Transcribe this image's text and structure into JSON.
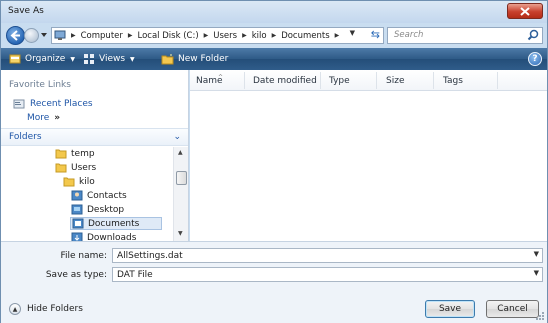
{
  "window": {
    "title": "Save As"
  },
  "address": {
    "crumbs": [
      "Computer",
      "Local Disk (C:)",
      "Users",
      "kilo",
      "Documents"
    ],
    "search_placeholder": "Search"
  },
  "toolbar": {
    "organize": "Organize",
    "views": "Views",
    "new_folder": "New Folder"
  },
  "nav": {
    "favorite_links_title": "Favorite Links",
    "favorites": [
      {
        "label": "Recent Places"
      }
    ],
    "more": "More",
    "more_glyph": "»",
    "folders_title": "Folders",
    "tree": [
      {
        "label": "temp"
      },
      {
        "label": "Users"
      },
      {
        "label": "kilo"
      },
      {
        "label": "Contacts"
      },
      {
        "label": "Desktop"
      },
      {
        "label": "Documents"
      },
      {
        "label": "Downloads"
      }
    ]
  },
  "filelist": {
    "columns": [
      "Name",
      "Date modified",
      "Type",
      "Size",
      "Tags"
    ]
  },
  "form": {
    "file_name_label": "File name:",
    "file_name_value": "AllSettings.dat",
    "save_as_type_label": "Save as type:",
    "save_as_type_value": "DAT File"
  },
  "footer": {
    "hide_folders": "Hide Folders",
    "save": "Save",
    "cancel": "Cancel"
  },
  "colors": {
    "toolbar_bg": "#2e5a86",
    "link_blue": "#1f56a7",
    "close_red": "#c8402d"
  }
}
